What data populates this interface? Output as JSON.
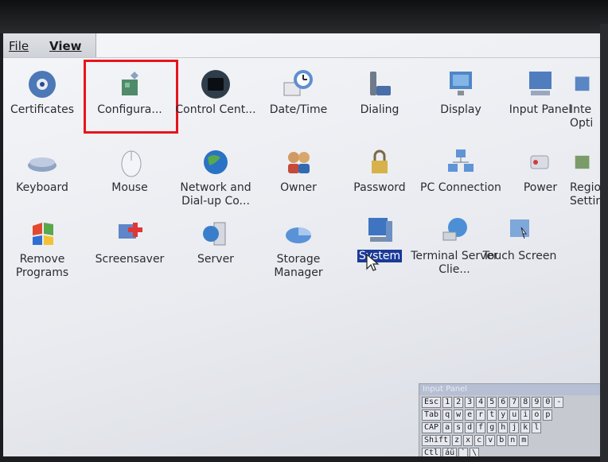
{
  "menu": {
    "file": "File",
    "view": "View"
  },
  "input_panel": {
    "title": "Input Panel",
    "rows": [
      [
        "Esc",
        "1",
        "2",
        "3",
        "4",
        "5",
        "6",
        "7",
        "8",
        "9",
        "0",
        "-"
      ],
      [
        "Tab",
        "q",
        "w",
        "e",
        "r",
        "t",
        "y",
        "u",
        "i",
        "o",
        "p"
      ],
      [
        "CAP",
        "a",
        "s",
        "d",
        "f",
        "g",
        "h",
        "j",
        "k",
        "l"
      ],
      [
        "Shift",
        "z",
        "x",
        "c",
        "v",
        "b",
        "n",
        "m"
      ],
      [
        "Ctl",
        "áü",
        "`",
        "\\"
      ]
    ]
  },
  "items": [
    {
      "label": "Certificates"
    },
    {
      "label": "Configura..."
    },
    {
      "label": "Control Cent..."
    },
    {
      "label": "Date/Time"
    },
    {
      "label": "Dialing"
    },
    {
      "label": "Display"
    },
    {
      "label": "Input Panel"
    },
    {
      "label": "Inte Opti"
    },
    {
      "label": "Keyboard"
    },
    {
      "label": "Mouse"
    },
    {
      "label": "Network and Dial-up Co..."
    },
    {
      "label": "Owner"
    },
    {
      "label": "Password"
    },
    {
      "label": "PC Connection"
    },
    {
      "label": "Power"
    },
    {
      "label": "Regio Setting"
    },
    {
      "label": "Remove Programs"
    },
    {
      "label": "Screensaver"
    },
    {
      "label": "Server"
    },
    {
      "label": "Storage Manager"
    },
    {
      "label": "System"
    },
    {
      "label": "Terminal Server Clie..."
    },
    {
      "label": "Touch Screen"
    }
  ]
}
